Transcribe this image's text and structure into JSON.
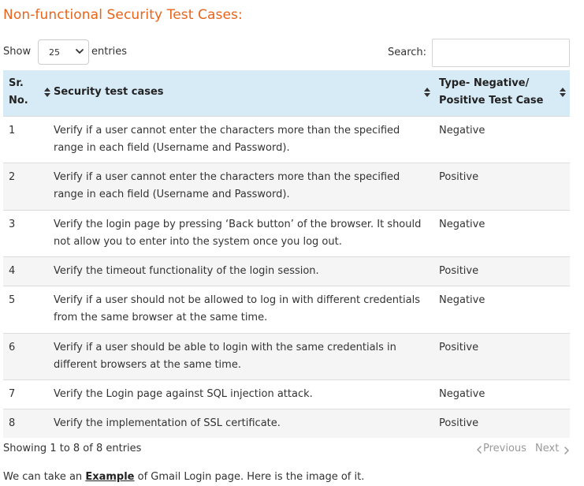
{
  "title": "Non-functional Security Test Cases:",
  "controls": {
    "show_label": "Show",
    "page_length": "25",
    "entries_label": "entries",
    "search_label": "Search:",
    "search_value": ""
  },
  "table": {
    "headers": [
      "Sr. No.",
      "Security test cases",
      "Type- Negative/ Positive Test Case"
    ],
    "header_lines": {
      "col1": [
        "Sr.",
        "No."
      ],
      "col2": [
        "Security test cases"
      ],
      "col3": [
        "Type- Negative/",
        "Positive Test Case"
      ]
    },
    "rows": [
      {
        "no": "1",
        "case": "Verify if a user cannot enter the characters more than the specified range in each field (Username and Password).",
        "type": "Negative"
      },
      {
        "no": "2",
        "case": "Verify if a user cannot enter the characters more than the specified range in each field (Username and Password).",
        "type": "Positive"
      },
      {
        "no": "3",
        "case": "Verify the login page by pressing ‘Back button’ of the browser. It should not allow you to enter into the system once you log out.",
        "type": "Negative"
      },
      {
        "no": "4",
        "case": "Verify the timeout functionality of the login session.",
        "type": "Positive"
      },
      {
        "no": "5",
        "case": "Verify if a user should not be allowed to log in with different credentials from the same browser at the same time.",
        "type": "Negative"
      },
      {
        "no": "6",
        "case": "Verify if a user should be able to login with the same credentials in different browsers at the same time.",
        "type": "Positive"
      },
      {
        "no": "7",
        "case": "Verify the Login page against SQL injection attack.",
        "type": "Negative"
      },
      {
        "no": "8",
        "case": "Verify the implementation of SSL certificate.",
        "type": "Positive"
      }
    ]
  },
  "info": "Showing 1 to 8 of 8 entries",
  "pager": {
    "previous": "Previous",
    "next": "Next"
  },
  "footer": {
    "before": "We can take an ",
    "link": "Example",
    "after": " of Gmail Login page. Here is the image of it."
  },
  "colors": {
    "title": "#e8641c",
    "header_bg": "#d7ebf7",
    "stripe": "#f5f5f5",
    "pager_disabled": "#999999"
  }
}
